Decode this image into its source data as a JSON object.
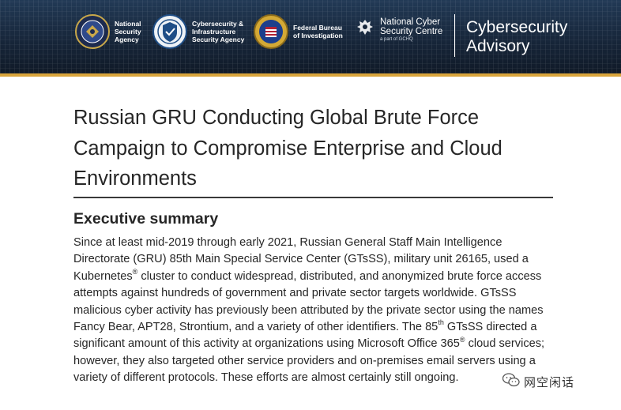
{
  "banner": {
    "agencies": [
      {
        "name": "National\nSecurity\nAgency",
        "seal": "nsa-seal-icon"
      },
      {
        "name": "Cybersecurity &\nInfrastructure\nSecurity Agency",
        "seal": "cisa-seal-icon"
      },
      {
        "name": "Federal Bureau\nof Investigation",
        "seal": "fbi-seal-icon"
      }
    ],
    "ncsc": {
      "name": "National Cyber\nSecurity Centre",
      "sub": "a part of GCHQ",
      "crest": "royal-crest-icon"
    },
    "doc_type": "Cybersecurity\nAdvisory",
    "accent_color": "#d8a43b"
  },
  "document": {
    "title": "Russian GRU Conducting Global Brute Force Campaign to Compromise Enterprise and Cloud Environments",
    "section_heading": "Executive summary",
    "paragraph": {
      "p1": "Since at least mid-2019 through early 2021, Russian General Staff Main Intelligence Directorate (GRU) 85th Main Special Service Center (GTsSS), military unit 26165, used a Kubernetes",
      "reg1": "®",
      "p2": " cluster to conduct widespread, distributed, and anonymized brute force access attempts against hundreds of government and private sector targets worldwide. GTsSS malicious cyber activity has previously been attributed by the private sector using the names Fancy Bear, APT28, Strontium, and a variety of other identifiers. The 85",
      "sup_th": "th",
      "p3": " GTsSS directed a significant amount of this activity at organizations using Microsoft Office 365",
      "reg2": "®",
      "p4": " cloud services; however, they also targeted other service providers and on-premises email servers using a variety of different protocols. These efforts are almost certainly still ongoing."
    }
  },
  "watermark": {
    "text": "网空闲话",
    "icon": "wechat-icon"
  }
}
